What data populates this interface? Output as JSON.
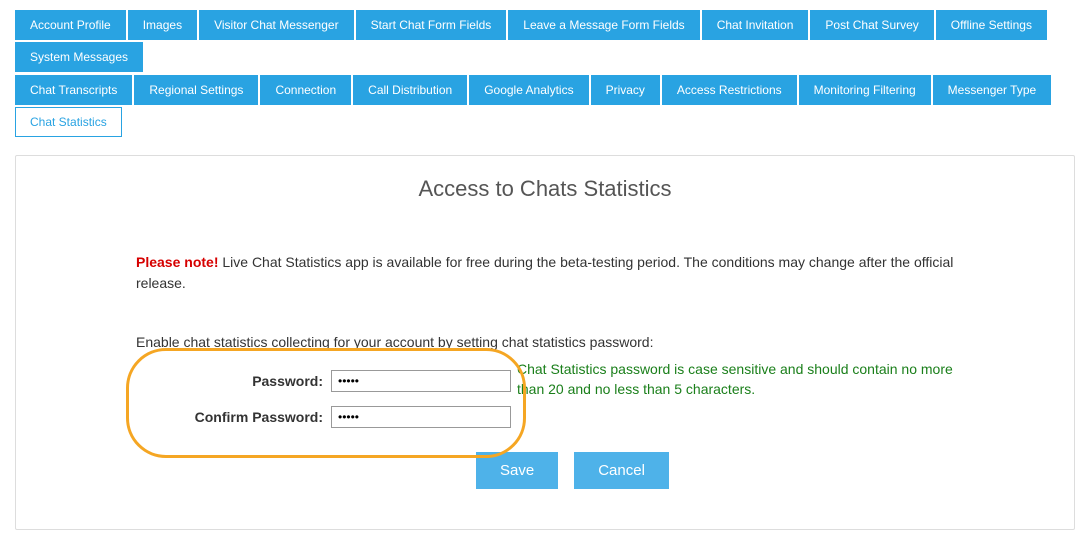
{
  "tabs_row1": [
    "Account Profile",
    "Images",
    "Visitor Chat Messenger",
    "Start Chat Form Fields",
    "Leave a Message Form Fields",
    "Chat Invitation",
    "Post Chat Survey",
    "Offline Settings",
    "System Messages"
  ],
  "tabs_row2": [
    "Chat Transcripts",
    "Regional Settings",
    "Connection",
    "Call Distribution",
    "Google Analytics",
    "Privacy",
    "Access Restrictions",
    "Monitoring Filtering",
    "Messenger Type",
    "Chat Statistics"
  ],
  "active_tab": "Chat Statistics",
  "panel": {
    "title": "Access to Chats Statistics",
    "note_bold": "Please note!",
    "note_text": " Live Chat Statistics app is available for free during the beta-testing period. The conditions may change after the official release.",
    "instruction": "Enable chat statistics collecting for your account by setting chat statistics password:",
    "password_label": "Password:",
    "confirm_label": "Confirm Password:",
    "password_value": "•••••",
    "confirm_value": "•••••",
    "hint": "Chat Statistics password is case sensitive and should contain no more than 20 and no less than 5 characters.",
    "save_label": "Save",
    "cancel_label": "Cancel"
  }
}
